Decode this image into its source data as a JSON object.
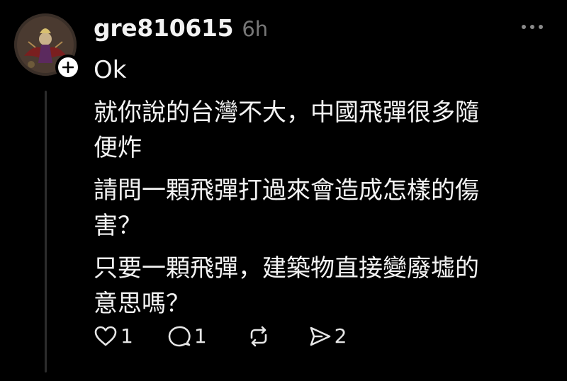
{
  "post": {
    "username": "gre810615",
    "timestamp": "6h",
    "lines": [
      "Ok",
      "就你說的台灣不大，中國飛彈很多隨",
      "便炸",
      "請問一顆飛彈打過來會造成怎樣的傷",
      "害？",
      "只要一顆飛彈，建築物直接變廢墟的",
      "意思嗎？"
    ]
  },
  "actions": {
    "likes": "1",
    "replies": "1",
    "shares": "2"
  },
  "icons": {
    "avatar": "avatar-image",
    "follow": "plus-icon",
    "more": "more-horizontal-icon",
    "like": "heart-icon",
    "reply": "comment-icon",
    "repost": "repost-icon",
    "share": "send-icon"
  },
  "colors": {
    "background": "#000000",
    "text": "#f3f3f3",
    "muted": "#777777"
  }
}
